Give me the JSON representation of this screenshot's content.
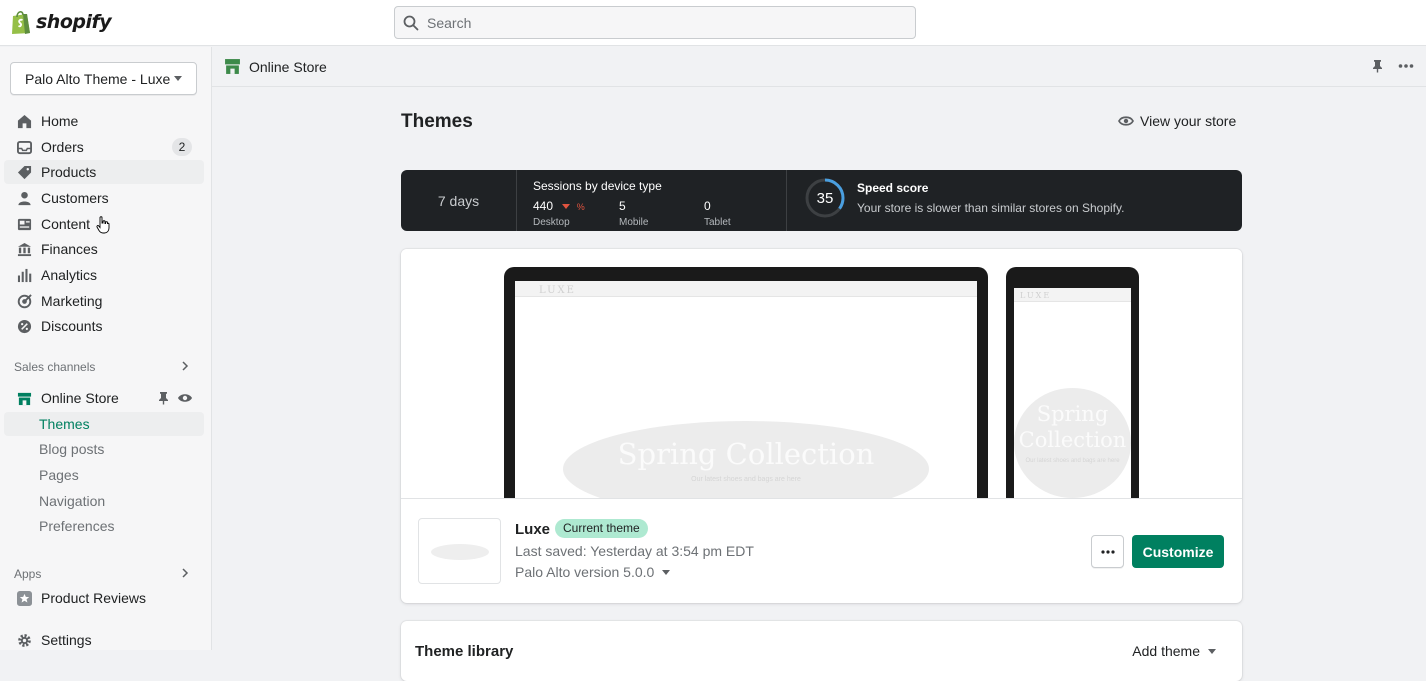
{
  "topbar": {
    "brand": "shopify",
    "search_placeholder": "Search"
  },
  "sidebar": {
    "store_name": "Palo Alto Theme - Luxe",
    "items": [
      {
        "label": "Home",
        "icon": "home-icon"
      },
      {
        "label": "Orders",
        "icon": "orders-icon",
        "badge": "2"
      },
      {
        "label": "Products",
        "icon": "tag-icon"
      },
      {
        "label": "Customers",
        "icon": "person-icon"
      },
      {
        "label": "Content",
        "icon": "content-icon"
      },
      {
        "label": "Finances",
        "icon": "bank-icon"
      },
      {
        "label": "Analytics",
        "icon": "bar-chart-icon"
      },
      {
        "label": "Marketing",
        "icon": "target-icon"
      },
      {
        "label": "Discounts",
        "icon": "discount-icon"
      }
    ],
    "sales_channels_title": "Sales channels",
    "online_store_label": "Online Store",
    "online_store_subitems": [
      "Themes",
      "Blog posts",
      "Pages",
      "Navigation",
      "Preferences"
    ],
    "apps_title": "Apps",
    "app_label": "Product Reviews",
    "settings_label": "Settings"
  },
  "breadcrumb": {
    "label": "Online Store"
  },
  "page": {
    "title": "Themes",
    "view_store_label": "View your store"
  },
  "stats": {
    "period": "7 days",
    "sessions_title": "Sessions by device type",
    "desktop_value": "440",
    "desktop_change": "%",
    "desktop_label": "Desktop",
    "mobile_value": "5",
    "mobile_label": "Mobile",
    "tablet_value": "0",
    "tablet_label": "Tablet",
    "speed_score": "35",
    "speed_title": "Speed score",
    "speed_desc": "Your store is slower than similar stores on Shopify."
  },
  "preview": {
    "brand": "LUXE",
    "hero_title": "Spring Collection",
    "hero_subtitle": "Our latest shoes and bags are here"
  },
  "theme": {
    "name": "Luxe",
    "badge": "Current theme",
    "last_saved": "Last saved: Yesterday at 3:54 pm EDT",
    "version": "Palo Alto version 5.0.0",
    "customize_label": "Customize"
  },
  "library": {
    "title": "Theme library",
    "add_theme_label": "Add theme"
  },
  "colors": {
    "accent": "#008060",
    "badge_green": "#aee9d1",
    "stats_bg": "#1f2225"
  }
}
